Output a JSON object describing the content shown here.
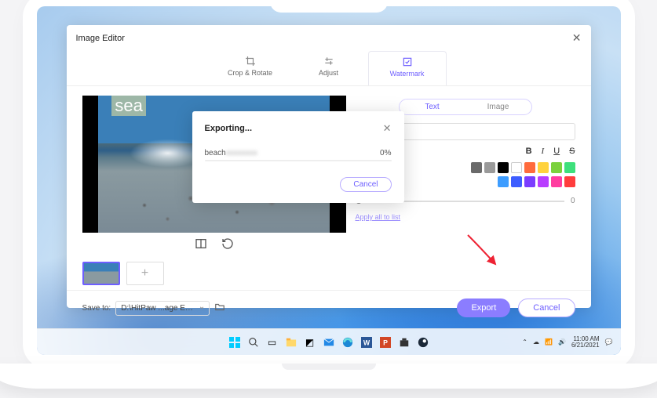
{
  "window": {
    "title": "Image Editor"
  },
  "tabs": {
    "crop": "Crop & Rotate",
    "adjust": "Adjust",
    "watermark": "Watermark"
  },
  "watermark": {
    "seg_text": "Text",
    "seg_image": "Image",
    "sample": "sea",
    "fmt": {
      "b": "B",
      "i": "I",
      "u": "U",
      "s": "S"
    },
    "row1": [
      "#6a6a6a",
      "#9a9a9a",
      "#000000",
      "#ffffff",
      "#ff6b3d",
      "#ffd23d",
      "#7bd13d",
      "#3de07b"
    ],
    "row2": [
      "#3d9dff",
      "#3d5dff",
      "#7b3dff",
      "#b83dff",
      "#ff3da0",
      "#ff3d3d"
    ],
    "opacity_end": "0",
    "apply": "Apply all to list"
  },
  "footer": {
    "save_label": "Save to:",
    "save_path": "D:\\HitPaw ...age Editor",
    "export": "Export",
    "cancel": "Cancel"
  },
  "modal": {
    "title": "Exporting...",
    "file": "beach",
    "file_blur": "xxxxxxxx",
    "pct": "0%",
    "cancel": "Cancel"
  },
  "tray": {
    "time": "11:00 AM",
    "date": "6/21/2021"
  }
}
